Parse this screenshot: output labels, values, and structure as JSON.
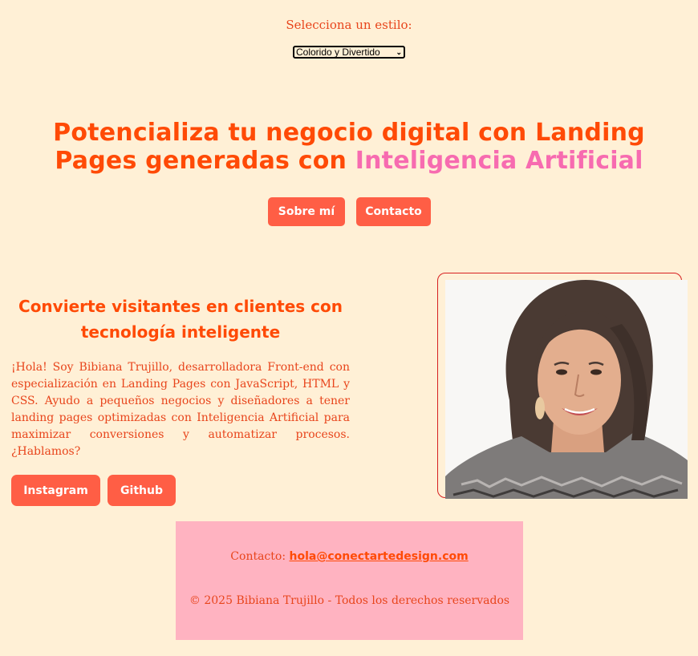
{
  "style_picker": {
    "label": "Selecciona un estilo:",
    "selected": "Colorido y Divertido"
  },
  "hero": {
    "title_main": "Potencializa tu negocio digital con Landing Pages generadas con",
    "title_accent": "Inteligencia Artificial",
    "buttons": [
      "Sobre mí",
      "Contacto"
    ]
  },
  "about": {
    "heading": "Convierte visitantes en clientes con tecnología inteligente",
    "text": "¡Hola! Soy Bibiana Trujillo, desarrolladora Front-end con especialización en Landing Pages con JavaScript, HTML y CSS. Ayudo a pequeños negocios y diseñadores a tener landing pages optimizadas con Inteligencia Artificial para maximizar conversiones y automatizar procesos. ¿Hablamos?",
    "buttons": [
      "Instagram",
      "Github"
    ]
  },
  "footer": {
    "contact_label": "Contacto:",
    "contact_email": "hola@conectartedesign.com",
    "copyright": "© 2025 Bibiana Trujillo - Todos los derechos reservados"
  },
  "colors": {
    "background": "#FFF0D6",
    "primary": "#FF4A06",
    "accent": "#F76BB0",
    "button": "#FF5E45",
    "footer_bg": "#FFB3C1"
  }
}
